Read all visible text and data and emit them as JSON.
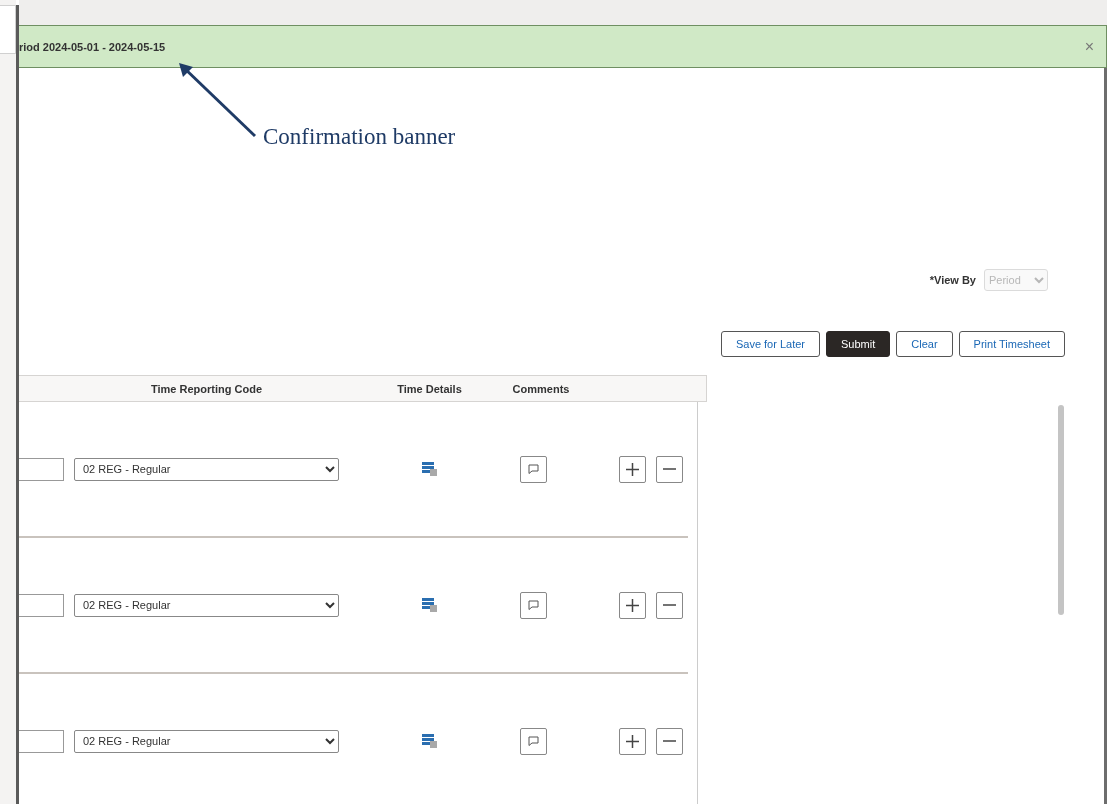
{
  "banner": {
    "message": "riod 2024-05-01 - 2024-05-15",
    "close": "×"
  },
  "annotation": {
    "label": "Confirmation banner"
  },
  "view_by": {
    "label": "*View By",
    "value": "Period",
    "disabled": true
  },
  "buttons": [
    {
      "label": "Save for Later",
      "primary": false
    },
    {
      "label": "Submit",
      "primary": true
    },
    {
      "label": "Clear",
      "primary": false
    },
    {
      "label": "Print Timesheet",
      "primary": false
    }
  ],
  "table": {
    "columns": [
      "Time Reporting Code",
      "Time Details",
      "Comments"
    ],
    "rows": [
      {
        "time_reporting_code": "02 REG - Regular"
      },
      {
        "time_reporting_code": "02 REG - Regular"
      },
      {
        "time_reporting_code": "02 REG - Regular"
      }
    ]
  }
}
